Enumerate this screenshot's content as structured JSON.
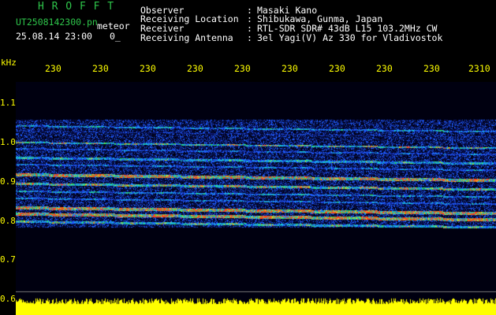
{
  "app_title": "H R O F F T",
  "filename": "UT2508142300.pn",
  "meteor_label": "meteor",
  "datetime": "25.08.14 23:00",
  "count": "0_",
  "info": {
    "observer_label": "Observer",
    "observer": "Masaki Kano",
    "location_label": "Receiving Location",
    "location": "Shibukawa, Gunma, Japan",
    "receiver_label": "Receiver",
    "receiver": "RTL-SDR SDR# 43dB L15 103.2MHz CW",
    "antenna_label": "Receiving Antenna",
    "antenna": "3el Yagi(V) Az 330 for Vladivostok",
    "colon": ":"
  },
  "colors": {
    "background": "#000000",
    "header_title": "#2ec44a",
    "axis": "#ffff00",
    "text": "#ffffff"
  },
  "chart_data": {
    "type": "heatmap",
    "yunit": "kHz",
    "ylim": [
      0.6,
      1.1
    ],
    "ytick_labels": [
      "1.1",
      "1.0",
      "0.9",
      "0.8",
      "0.7",
      "0.6"
    ],
    "xtick_labels": [
      "230",
      "230",
      "230",
      "230",
      "230",
      "230",
      "230",
      "230",
      "230",
      "2310"
    ],
    "grid": false
  }
}
